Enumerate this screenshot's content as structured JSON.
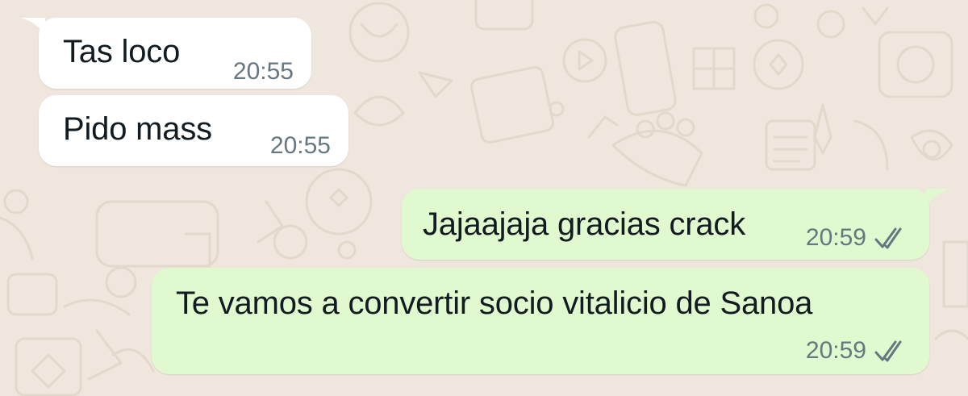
{
  "chat": {
    "messages": [
      {
        "direction": "incoming",
        "text": "Tas loco",
        "time": "20:55"
      },
      {
        "direction": "incoming",
        "text": "Pido mass",
        "time": "20:55"
      },
      {
        "direction": "outgoing",
        "text": "Jajaajaja gracias crack",
        "time": "20:59",
        "status_icon": "double-check-icon"
      },
      {
        "direction": "outgoing",
        "text": "Te vamos a convertir socio vitalicio de Sanoa",
        "time": "20:59",
        "status_icon": "double-check-icon"
      }
    ]
  },
  "colors": {
    "background": "#efe7dd",
    "incoming_bubble": "#ffffff",
    "outgoing_bubble": "#e1f9cf",
    "timestamp": "#667781"
  }
}
